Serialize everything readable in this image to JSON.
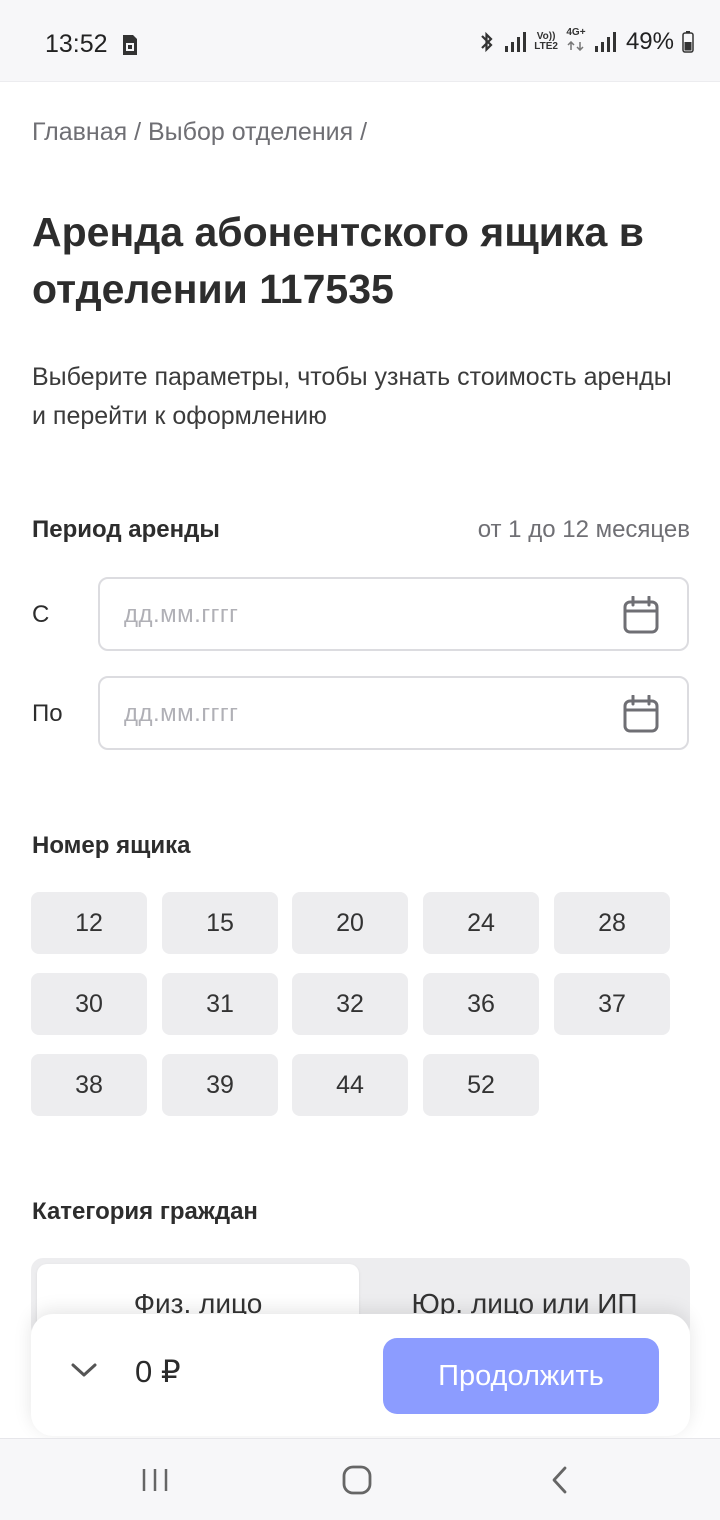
{
  "status_bar": {
    "time": "13:52",
    "network_top": "Vo))",
    "network_bottom": "LTE2",
    "network_type": "4G+",
    "battery": "49%"
  },
  "breadcrumb": "Главная / Выбор отделения /",
  "title": "Аренда абонентского ящика в отделении 117535",
  "subtitle": "Выберите параметры, чтобы узнать стоимость аренды и перейти к оформлению",
  "period": {
    "title": "Период аренды",
    "hint": "от 1 до 12 месяцев",
    "from_label": "С",
    "to_label": "По",
    "placeholder": "дд.мм.гггг"
  },
  "boxes": {
    "title": "Номер ящика",
    "numbers": [
      "12",
      "15",
      "20",
      "24",
      "28",
      "30",
      "31",
      "32",
      "36",
      "37",
      "38",
      "39",
      "44",
      "52"
    ]
  },
  "category": {
    "title": "Категория граждан",
    "options": [
      "Физ. лицо",
      "Юр. лицо или ИП"
    ],
    "selected": "Физ. лицо"
  },
  "footer": {
    "total": "0 ₽",
    "continue_label": "Продолжить"
  },
  "colors": {
    "accent": "#8c9cff",
    "chip_bg": "#ededef",
    "text_primary": "#2d2d2d",
    "text_secondary": "#6f6f74"
  }
}
